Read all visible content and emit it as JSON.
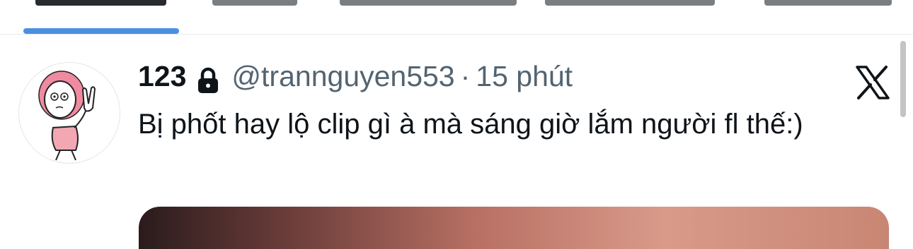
{
  "tabs": {
    "active_index": 0,
    "indicator_color": "#4a90e2"
  },
  "tweet": {
    "display_name": "123",
    "protected_icon": "lock-icon",
    "handle": "@trannguyen553",
    "separator": "·",
    "time": "15 phút",
    "text": "Bị phốt hay lộ clip gì à mà sáng giờ lắm người fl thế:)",
    "brand_icon": "x-logo-icon"
  }
}
